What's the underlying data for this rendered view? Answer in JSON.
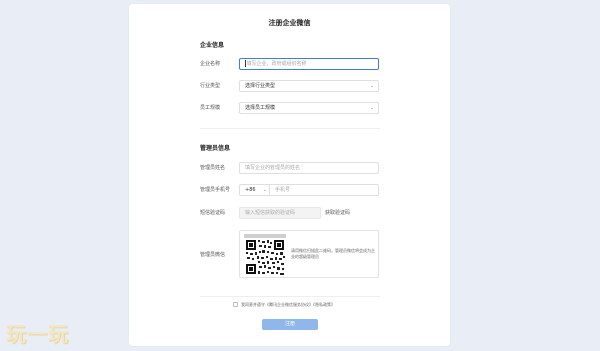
{
  "page": {
    "title": "注册企业微信"
  },
  "section_company": {
    "heading": "企业信息",
    "name_label": "企业名称",
    "name_placeholder": "填写企业、政府或组织名称",
    "industry_label": "行业类型",
    "industry_value": "选择行业类型",
    "size_label": "员工规模",
    "size_value": "选择员工规模"
  },
  "section_admin": {
    "heading": "管理员信息",
    "admin_name_label": "管理员姓名",
    "admin_name_placeholder": "填写企业的管理员的姓名",
    "phone_label": "管理员手机号",
    "country_code": "+86",
    "phone_placeholder": "手机号",
    "sms_label": "短信验证码",
    "sms_placeholder": "输入短信获取的验证码",
    "sms_button": "获取验证码",
    "wechat_label": "管理员微信",
    "qr_instruction": "请用微信扫描此二维码，管理员微信将会成为企业的超级管理员"
  },
  "footer": {
    "agreement_text": "我同意并遵守《腾讯企业微信服务协议》《隐私政策》",
    "submit_label": "注册"
  },
  "watermark": "玩一玩"
}
